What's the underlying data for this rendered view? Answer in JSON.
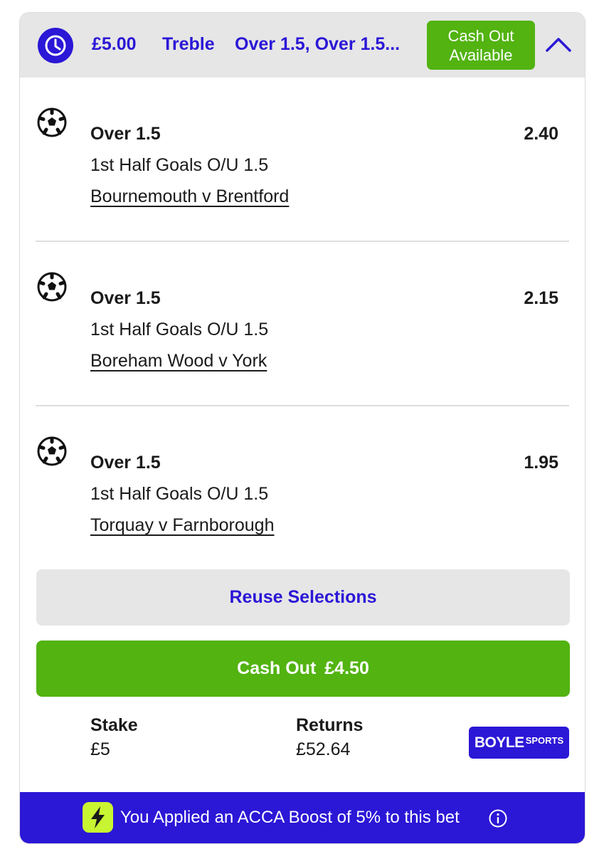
{
  "header": {
    "stake": "£5.00",
    "bet_type": "Treble",
    "selections_summary": "Over 1.5, Over 1.5...",
    "cashout_badge": [
      "Cash Out",
      "Available"
    ]
  },
  "legs": [
    {
      "selection": "Over 1.5",
      "odds": "2.40",
      "market": "1st Half Goals O/U 1.5",
      "event": "Bournemouth v Brentford"
    },
    {
      "selection": "Over 1.5",
      "odds": "2.15",
      "market": "1st Half Goals O/U 1.5",
      "event": "Boreham Wood v York"
    },
    {
      "selection": "Over 1.5",
      "odds": "1.95",
      "market": "1st Half Goals O/U 1.5",
      "event": "Torquay v Farnborough"
    }
  ],
  "actions": {
    "reuse_label": "Reuse Selections",
    "cashout_label": "Cash Out",
    "cashout_amount": "£4.50"
  },
  "summary": {
    "stake_label": "Stake",
    "stake_value": "£5",
    "returns_label": "Returns",
    "returns_value": "£52.64"
  },
  "brand": {
    "logo_main": "BOYLE",
    "logo_sub": "SPORTS"
  },
  "boost": {
    "text": "You Applied an ACCA Boost of 5% to this bet"
  },
  "colors": {
    "accent_blue": "#2b17d6",
    "green": "#52b311",
    "boost_icon": "#c8f531"
  },
  "icons": {
    "header": "clock-icon",
    "collapse": "chevron-up-icon",
    "leg": "football-icon",
    "boost": "lightning-icon",
    "info": "info-icon"
  }
}
